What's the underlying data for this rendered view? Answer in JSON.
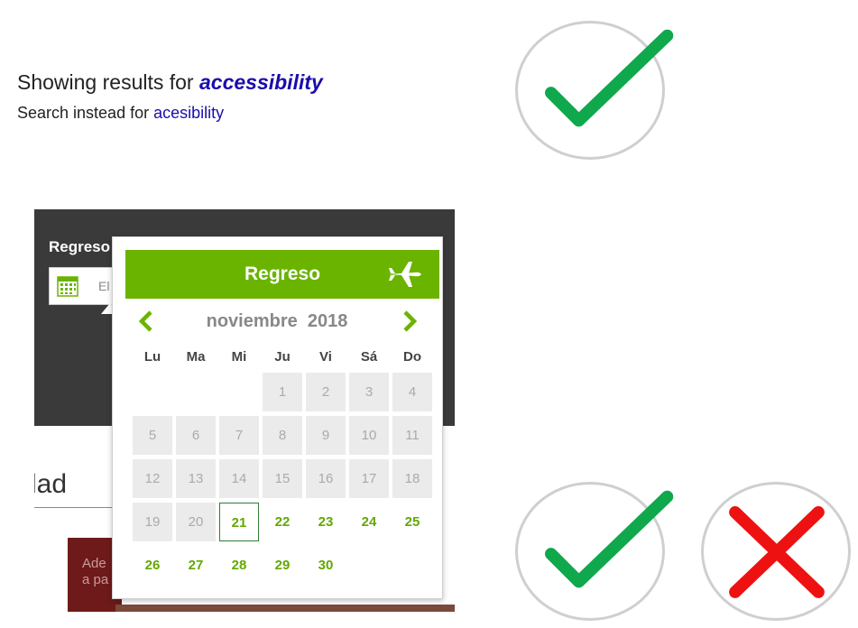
{
  "search": {
    "showing_prefix": "Showing results for ",
    "showing_term": "accessibility",
    "instead_prefix": "Search instead for ",
    "instead_term": "acesibility"
  },
  "background": {
    "label": "Regreso",
    "input_value": "El",
    "heading": "lad",
    "photo_text_1": "Ade",
    "photo_text_2": "a pa"
  },
  "picker": {
    "title": "Regreso",
    "month": "noviembre",
    "year": "2018",
    "weekdays": [
      "Lu",
      "Ma",
      "Mi",
      "Ju",
      "Vi",
      "Sá",
      "Do"
    ],
    "days": [
      "",
      "",
      "",
      "1",
      "2",
      "3",
      "4",
      "5",
      "6",
      "7",
      "8",
      "9",
      "10",
      "11",
      "12",
      "13",
      "14",
      "15",
      "16",
      "17",
      "18",
      "19",
      "20",
      "21",
      "22",
      "23",
      "24",
      "25",
      "26",
      "27",
      "28",
      "29",
      "30",
      "",
      ""
    ],
    "first_available_day": 21,
    "today": 21,
    "colors": {
      "header": "#6ab400",
      "available": "#63a800",
      "disabled_bg": "#ebebeb"
    }
  },
  "badges": {
    "top": "check-icon",
    "bottom_left": "check-icon",
    "bottom_right": "cross-icon",
    "check_color": "#10a84c",
    "cross_color": "#ee1111"
  }
}
